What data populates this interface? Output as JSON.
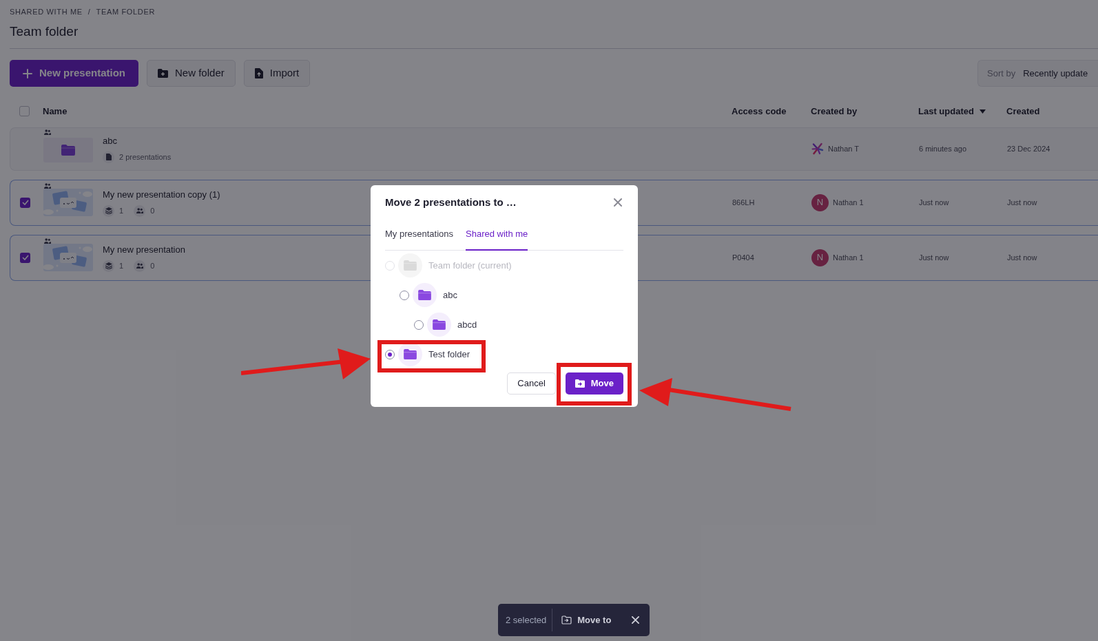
{
  "breadcrumb": {
    "items": [
      "SHARED WITH ME",
      "TEAM FOLDER"
    ],
    "separator": "/"
  },
  "title": "Team folder",
  "toolbar": [
    {
      "label": "New presentation",
      "kind": "primary"
    },
    {
      "label": "New folder",
      "kind": "folder"
    },
    {
      "label": "Import",
      "kind": "import"
    }
  ],
  "sort": {
    "label": "Sort by",
    "value": "Recently update"
  },
  "table": {
    "select_all": {
      "checked": false
    },
    "columns": [
      {
        "label": "Name",
        "sorted": false
      },
      {
        "label": "Access code",
        "sorted": false
      },
      {
        "label": "Created by",
        "sorted": false
      },
      {
        "label": "Last updated",
        "sorted": true
      },
      {
        "label": "Created",
        "sorted": false
      }
    ],
    "rows": [
      {
        "kind": "folder",
        "checked": false,
        "name": "abc",
        "meta": "2 presentations",
        "access_code": "",
        "created_by": {
          "kind": "logo",
          "name": "Nathan T"
        },
        "last_updated": "6 minutes ago",
        "created": "23 Dec 2024"
      },
      {
        "kind": "presentation",
        "checked": true,
        "name": "My new presentation copy (1)",
        "slides": "1",
        "viewers": "0",
        "access_code": "866LH",
        "created_by": {
          "kind": "letter",
          "letter": "N",
          "name": "Nathan 1"
        },
        "last_updated": "Just now",
        "created": "Just now"
      },
      {
        "kind": "presentation",
        "checked": true,
        "name": "My new presentation",
        "slides": "1",
        "viewers": "0",
        "access_code": "P0404",
        "created_by": {
          "kind": "letter",
          "letter": "N",
          "name": "Nathan 1"
        },
        "last_updated": "Just now",
        "created": "Just now"
      }
    ]
  },
  "dialog": {
    "title": "Move 2 presentations to …",
    "tabs": [
      {
        "label": "My presentations",
        "selected": false
      },
      {
        "label": "Shared with me",
        "selected": true
      }
    ],
    "tree": [
      {
        "label": "Team folder (current)",
        "disabled": true,
        "selected": false,
        "children": [
          {
            "label": "abc",
            "disabled": false,
            "selected": false,
            "children": [
              {
                "label": "abcd",
                "disabled": false,
                "selected": false
              }
            ]
          }
        ]
      },
      {
        "label": "Test folder",
        "disabled": false,
        "selected": true
      }
    ],
    "buttons": [
      {
        "label": "Cancel",
        "kind": "secondary"
      },
      {
        "label": "Move",
        "kind": "primary"
      }
    ]
  },
  "selection_bar": {
    "count": "2 selected",
    "action": "Move to"
  }
}
